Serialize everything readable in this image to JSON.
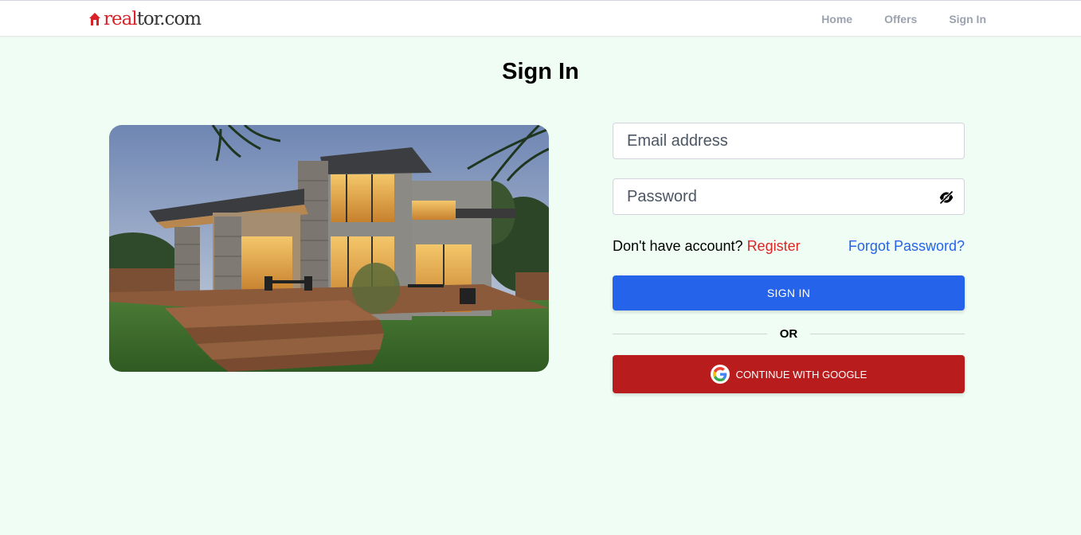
{
  "header": {
    "logo": {
      "part1": "real",
      "part2": "tor.com"
    },
    "nav": [
      "Home",
      "Offers",
      "Sign In"
    ]
  },
  "page": {
    "title": "Sign In"
  },
  "form": {
    "email_placeholder": "Email address",
    "password_placeholder": "Password",
    "no_account_text": "Don't have account?",
    "register_label": "Register",
    "forgot_label": "Forgot Password?",
    "signin_label": "SIGN IN",
    "or_label": "OR",
    "google_label": "CONTINUE WITH GOOGLE"
  },
  "colors": {
    "background": "#effdf4",
    "primary": "#2563eb",
    "google_button": "#b91c1c",
    "register": "#dc2626",
    "brand_red": "#d92228"
  },
  "icons": {
    "logo_house": "house-icon",
    "password_toggle": "eye-slash-icon",
    "google": "google-icon"
  }
}
